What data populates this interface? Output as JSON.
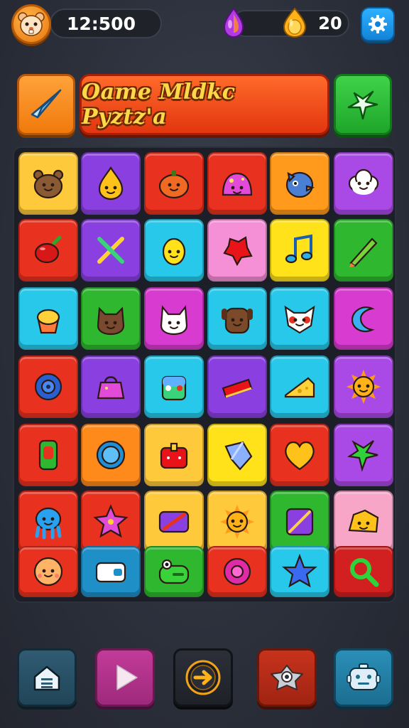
{
  "header": {
    "score": "12:500",
    "coins": "20",
    "avatar_icon": "hamster-face-icon",
    "gem_icon": "purple-gem-icon",
    "coin_icon": "gold-coin-icon",
    "settings_icon": "gear-icon"
  },
  "title_row": {
    "title": "Oame Mldkc Pyztz'a",
    "left_button_icon": "paper-plane-icon",
    "right_button_icon": "star-icon"
  },
  "board": {
    "rows": [
      [
        {
          "icon": "bear-icon",
          "color": "#ffc93c"
        },
        {
          "icon": "drop-face-icon",
          "color": "#8a3fe0"
        },
        {
          "icon": "pumpkin-face-icon",
          "color": "#e8321f"
        },
        {
          "icon": "pink-slime-icon",
          "color": "#e8321f"
        },
        {
          "icon": "blue-bird-icon",
          "color": "#ff9a1c"
        },
        {
          "icon": "cloud-face-icon",
          "color": "#a94ae6"
        }
      ],
      [
        {
          "icon": "chili-pepper-icon",
          "color": "#e8321f"
        },
        {
          "icon": "crossed-swords-icon",
          "color": "#8a3fe0"
        },
        {
          "icon": "lemon-face-icon",
          "color": "#28c8ea"
        },
        {
          "icon": "red-splat-icon",
          "color": "#f58fd6"
        },
        {
          "icon": "music-note-icon",
          "color": "#ffe21a"
        },
        {
          "icon": "pencil-icon",
          "color": "#2fb82f"
        }
      ],
      [
        {
          "icon": "cupcake-icon",
          "color": "#28c8ea"
        },
        {
          "icon": "brown-cat-icon",
          "color": "#2fb82f"
        },
        {
          "icon": "white-cat-icon",
          "color": "#d83bd0"
        },
        {
          "icon": "brown-dog-icon",
          "color": "#28c8ea"
        },
        {
          "icon": "white-fox-icon",
          "color": "#28c8ea"
        },
        {
          "icon": "blue-moon-icon",
          "color": "#d83bd0"
        }
      ],
      [
        {
          "icon": "blue-gear-icon",
          "color": "#e8321f"
        },
        {
          "icon": "pink-bag-icon",
          "color": "#8a3fe0"
        },
        {
          "icon": "robot-face-icon",
          "color": "#28c8ea"
        },
        {
          "icon": "red-tray-icon",
          "color": "#8a3fe0"
        },
        {
          "icon": "cheese-icon",
          "color": "#28c8ea"
        },
        {
          "icon": "sun-face-icon",
          "color": "#a94ae6"
        }
      ],
      [
        {
          "icon": "green-phone-icon",
          "color": "#e8321f"
        },
        {
          "icon": "blue-flower-icon",
          "color": "#ff8a1c"
        },
        {
          "icon": "red-bag-icon",
          "color": "#ffc93c"
        },
        {
          "icon": "blue-crystal-icon",
          "color": "#ffe21a"
        },
        {
          "icon": "heart-icon",
          "color": "#e8321f"
        },
        {
          "icon": "green-star-icon",
          "color": "#a94ae6"
        }
      ],
      [
        {
          "icon": "blue-octopus-icon",
          "color": "#e8321f"
        },
        {
          "icon": "pink-star-icon",
          "color": "#e8321f"
        },
        {
          "icon": "card-slash-icon",
          "color": "#ffc93c"
        },
        {
          "icon": "sun-face-icon",
          "color": "#ffc93c"
        },
        {
          "icon": "purple-square-icon",
          "color": "#2fb82f"
        },
        {
          "icon": "cheese-face-icon",
          "color": "#f7a6c8"
        }
      ],
      [
        {
          "icon": "orange-face-icon",
          "color": "#e8321f"
        },
        {
          "icon": "wallet-icon",
          "color": "#1f8fc8"
        },
        {
          "icon": "green-frog-icon",
          "color": "#2fb82f"
        },
        {
          "icon": "pink-donut-icon",
          "color": "#e8321f"
        },
        {
          "icon": "blue-star-icon",
          "color": "#28c8ea"
        },
        {
          "icon": "magnifier-icon",
          "color": "#d21f1f"
        }
      ]
    ]
  },
  "bottom_nav": [
    {
      "name": "home",
      "icon": "home-icon"
    },
    {
      "name": "play",
      "icon": "play-icon"
    },
    {
      "name": "boost",
      "icon": "arrow-badge-icon"
    },
    {
      "name": "pet",
      "icon": "creature-icon"
    },
    {
      "name": "shop",
      "icon": "robot-icon"
    }
  ]
}
